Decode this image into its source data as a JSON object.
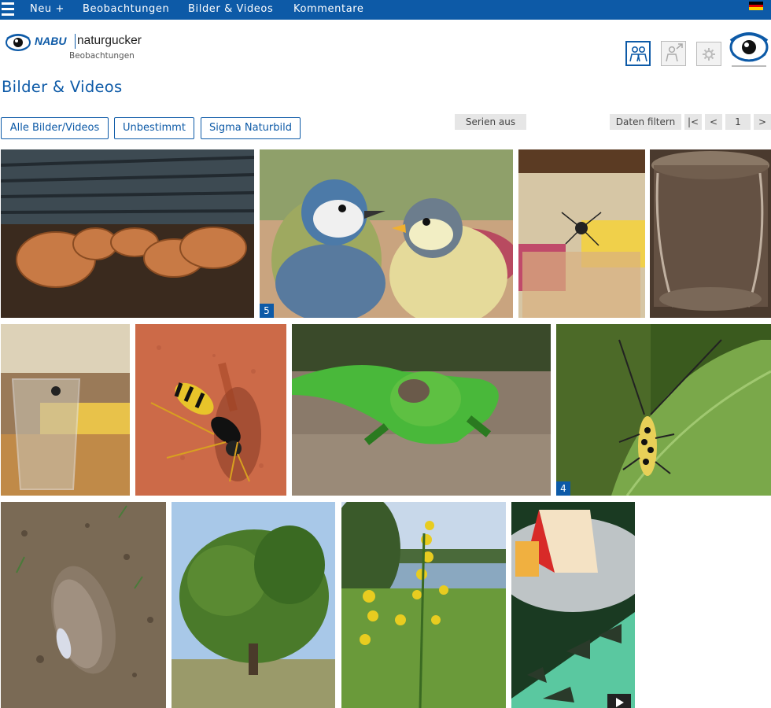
{
  "topbar": {
    "nav": [
      {
        "label": "Neu +"
      },
      {
        "label": "Beobachtungen"
      },
      {
        "label": "Bilder & Videos"
      },
      {
        "label": "Kommentare"
      }
    ],
    "flag_colors": [
      "#000000",
      "#dd0000",
      "#ffce00"
    ]
  },
  "logo": {
    "brand": "NABU",
    "product": "naturgucker",
    "subtitle": "Beobachtungen"
  },
  "header_icons": [
    "community-icon",
    "share-profile-icon",
    "settings-icon",
    "naturgucker-eye-icon"
  ],
  "page": {
    "title": "Bilder & Videos"
  },
  "filters": {
    "buttons": [
      {
        "label": "Alle Bilder/Videos"
      },
      {
        "label": "Unbestimmt"
      },
      {
        "label": "Sigma Naturbild"
      }
    ],
    "series_toggle": "Serien aus",
    "data_filter": "Daten filtern",
    "pager": {
      "first": "|<",
      "prev": "<",
      "page": "1",
      "next": ">"
    }
  },
  "gallery": {
    "items": [
      {
        "subject": "bracket-fungus",
        "badge": ""
      },
      {
        "subject": "blue-tits",
        "badge": "5"
      },
      {
        "subject": "spider-jar",
        "badge": ""
      },
      {
        "subject": "glass-jar",
        "badge": ""
      },
      {
        "subject": "spider-glass",
        "badge": ""
      },
      {
        "subject": "wasp",
        "badge": ""
      },
      {
        "subject": "sand-lizard",
        "badge": ""
      },
      {
        "subject": "longhorn-beetle",
        "badge": "4"
      },
      {
        "subject": "mussel-shell",
        "badge": ""
      },
      {
        "subject": "tree",
        "badge": ""
      },
      {
        "subject": "goldenrod-river",
        "badge": ""
      },
      {
        "subject": "apple-video",
        "badge": "",
        "media": "video"
      }
    ]
  },
  "colors": {
    "brand_blue": "#0d5aa7"
  }
}
